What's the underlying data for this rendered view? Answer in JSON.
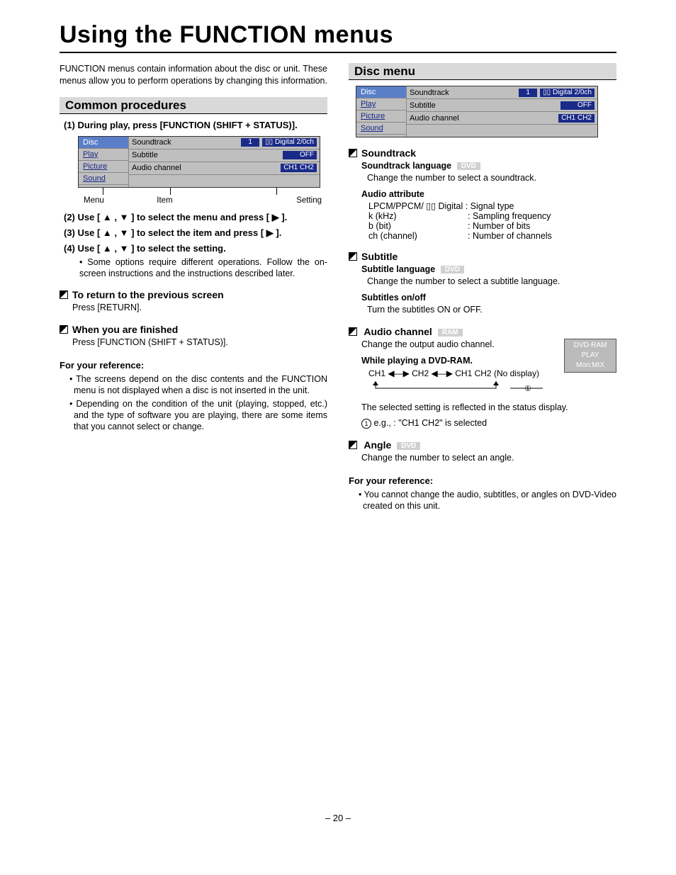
{
  "title": "Using the FUNCTION menus",
  "intro": "FUNCTION menus contain information about the disc or unit. These menus allow you to perform operations by changing this information.",
  "common": {
    "heading": "Common procedures",
    "step1": "(1) During play, press [FUNCTION (SHIFT + STATUS)].",
    "osd": {
      "menus": [
        "Disc",
        "Play",
        "Picture",
        "Sound"
      ],
      "rows": [
        {
          "item": "Soundtrack",
          "set1": "1",
          "set2": "▯▯ Digital 2/0ch"
        },
        {
          "item": "Subtitle",
          "set2": "OFF"
        },
        {
          "item": "Audio channel",
          "set2": "CH1 CH2"
        }
      ],
      "labels": {
        "menu": "Menu",
        "item": "Item",
        "setting": "Setting"
      }
    },
    "step2": "(2) Use [ ▲ , ▼ ] to select the menu and press [ ▶ ].",
    "step3": "(3) Use [ ▲ , ▼ ] to select the item and press [ ▶ ].",
    "step4": "(4) Use [ ▲ , ▼ ] to select the setting.",
    "step4_note": "• Some options require different operations. Follow the on-screen instructions and the instructions described later.",
    "return_heading": "To return to the previous screen",
    "return_text": "Press [RETURN].",
    "finish_heading": "When you are finished",
    "finish_text": "Press [FUNCTION (SHIFT + STATUS)].",
    "ref_heading": "For your reference:",
    "ref1": "• The screens depend on the disc contents and the FUNCTION menu is not displayed when a disc is not inserted in the unit.",
    "ref2": "• Depending on the condition of the unit (playing, stopped, etc.) and the type of software you are playing, there are some items that you cannot select or change."
  },
  "disc": {
    "heading": "Disc menu",
    "soundtrack": {
      "heading": "Soundtrack",
      "lang_label": "Soundtrack language",
      "lang_badge": "DVD",
      "lang_text": "Change the number to select a soundtrack.",
      "attr_label": "Audio attribute",
      "attr0": "LPCM/PPCM/ ▯▯ Digital : Signal type",
      "attrs": [
        {
          "k": "k (kHz)",
          "v": ": Sampling frequency"
        },
        {
          "k": "b (bit)",
          "v": ": Number of bits"
        },
        {
          "k": "ch (channel)",
          "v": ": Number of channels"
        }
      ]
    },
    "subtitle": {
      "heading": "Subtitle",
      "lang_label": "Subtitle language",
      "lang_badge": "DVD",
      "lang_text": "Change the number to select a subtitle language.",
      "onoff_label": "Subtitles on/off",
      "onoff_text": "Turn the subtitles ON or OFF."
    },
    "audio": {
      "heading": "Audio channel",
      "heading_badge": "RAM",
      "text": "Change the output audio channel.",
      "while_label": "While playing a DVD-RAM.",
      "diagram": "CH1 ◀—▶ CH2 ◀—▶ CH1 CH2  (No display)",
      "reflected": "The selected setting is reflected in the status display.",
      "example": "e.g., : \"CH1 CH2\" is selected",
      "statbox": {
        "l1": "DVD-RAM",
        "l2": "PLAY",
        "l3": "Mon:MIX"
      }
    },
    "angle": {
      "heading": "Angle",
      "badge": "DVD",
      "text": "Change the number to select an angle."
    },
    "ref_heading": "For your reference:",
    "ref1": "• You cannot change the audio, subtitles, or angles on DVD-Video created on this unit."
  },
  "page_number": "– 20 –"
}
